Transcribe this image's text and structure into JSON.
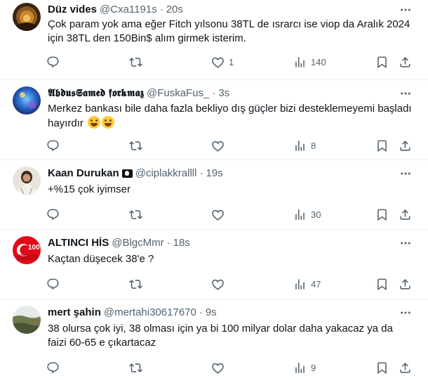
{
  "tweets": [
    {
      "name": "Düz vides",
      "handle": "@Cxa1191s",
      "time": "20s",
      "text": "Çok param yok ama eğer Fitch yılsonu 38TL de ısrarcı ise viop da Aralık 2024 için 38TL den 150Bin$ alım girmek isterim.",
      "reply_count": "",
      "retweet_count": "",
      "like_count": "1",
      "view_count": "140"
    },
    {
      "name": "𝕬𝖇𝖉𝖚𝖘𝕾𝖆𝖒𝖊𝖉 𝖋𝖔𝖗𝖐𝖒𝖆𝖟",
      "handle": "@FuskaFus_",
      "time": "3s",
      "text": "Merkez bankası bile daha fazla bekliyo dış güçler bizi desteklemeyemi başladı hayırdır",
      "reply_count": "",
      "retweet_count": "",
      "like_count": "",
      "view_count": "8"
    },
    {
      "name": "Kaan Durukan",
      "handle": "@ciplakkrallll",
      "time": "19s",
      "text": "+%15 çok iyimser",
      "reply_count": "",
      "retweet_count": "",
      "like_count": "",
      "view_count": "30"
    },
    {
      "name": "ALTINCI HİS",
      "handle": "@BlgcMmr",
      "time": "18s",
      "text": "Kaçtan düşecek 38'e ?",
      "reply_count": "",
      "retweet_count": "",
      "like_count": "",
      "view_count": "47"
    },
    {
      "name": "mert şahin",
      "handle": "@mertahi30617670",
      "time": "9s",
      "text": "38 olursa çok iyi, 38 olması için ya bi 100 milyar dolar daha yakacaz ya da faizi 60-65 e çıkartacaz",
      "reply_count": "",
      "retweet_count": "",
      "like_count": "",
      "view_count": "9"
    }
  ],
  "separator": "·",
  "avatar_3_badge": "100",
  "colors": {
    "text": "#0f1419",
    "secondary": "#536471",
    "divider": "#eff3f4"
  },
  "icons": [
    "reply-icon",
    "retweet-icon",
    "like-icon",
    "views-icon",
    "bookmark-icon",
    "share-icon",
    "more-icon",
    "pirate-flag-icon",
    "grin-emoji"
  ]
}
